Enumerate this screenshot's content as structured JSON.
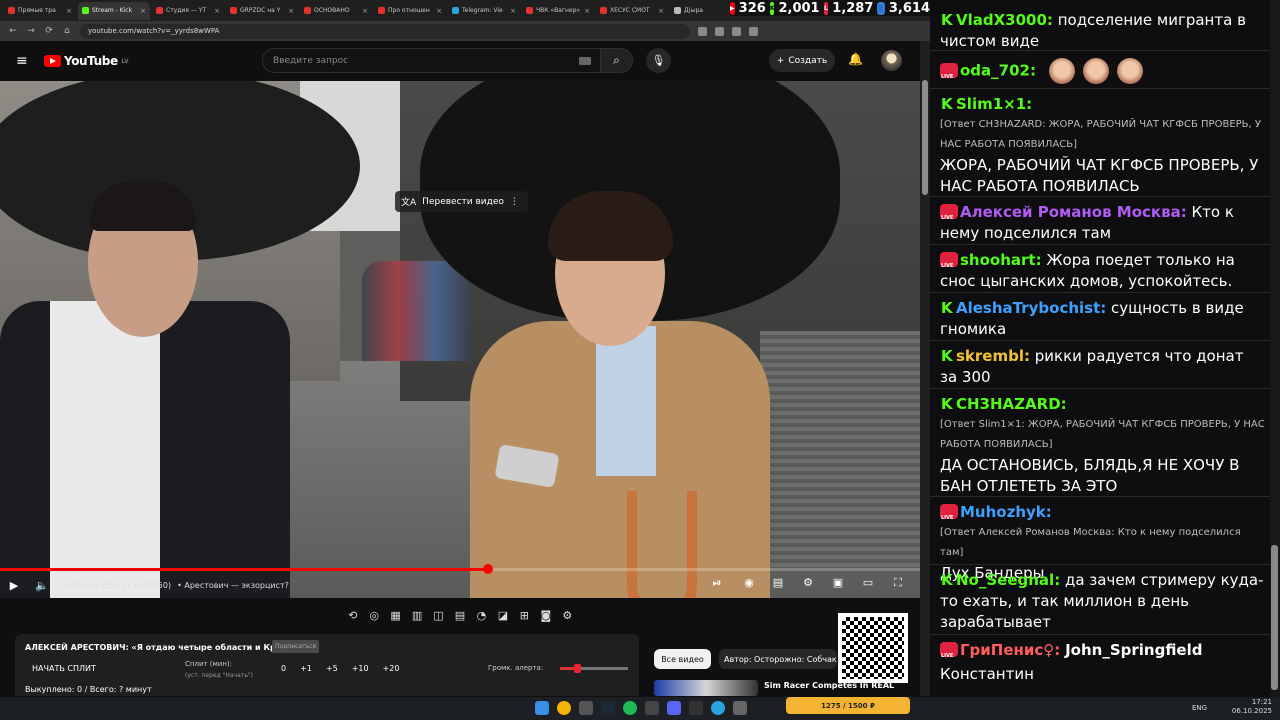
{
  "browser": {
    "tabs": [
      {
        "label": "Прямые тра",
        "color": "#e5302d"
      },
      {
        "label": "Stream - Kick",
        "color": "#53fc18"
      },
      {
        "label": "Студия — YT",
        "color": "#e5302d"
      },
      {
        "label": "GRPZDC на Y",
        "color": "#e5302d"
      },
      {
        "label": "ОСНОВАНО",
        "color": "#e5302d"
      },
      {
        "label": "Про отношен",
        "color": "#e5302d"
      },
      {
        "label": "Telegram: Vie",
        "color": "#2aa3df"
      },
      {
        "label": "ЧВК «Вагнер»",
        "color": "#e5302d"
      },
      {
        "label": "ХЕСУС СМОТ",
        "color": "#e5302d"
      },
      {
        "label": "Д|ыра",
        "color": "#bbbbbb"
      }
    ],
    "url": "youtube.com/watch?v=_yyrds8wWPA"
  },
  "stream_stats": {
    "youtube": "326",
    "kick": "2,001",
    "live": "1,287",
    "total": "3,614"
  },
  "youtube": {
    "logo_text": "YouTube",
    "region": "LV",
    "search_placeholder": "Введите запрос",
    "create_label": "Создать",
    "translate_label": "Перевести видео",
    "time": "1:31:15 / 2:54:11 (2:50:50)",
    "chapter": "• Арестович — экзорцист?",
    "progress": 0.53
  },
  "panel": {
    "title": "АЛЕКСЕЙ АРЕСТОВИЧ: «Я отдаю четыре области и Крым»",
    "subscribe": "Подписаться",
    "split_button": "НАЧАТЬ СПЛИТ",
    "split_label": "Сплит (мин):",
    "split_hint": "(уст. перед \"Начать\")",
    "split_values": [
      "0",
      "+1",
      "+5",
      "+10",
      "+20"
    ],
    "alert_label": "Громк. алерта:",
    "alert_level": 0.3,
    "bought": "Выкуплено: 0 / Всего: ? минут"
  },
  "recommendations": {
    "all_videos": "Все видео",
    "author": "Автор: Осторожно: Собчак",
    "rec_title": "Sim Racer Competes In REAL"
  },
  "donation_bar": "1275 / 1500 ₽",
  "chat": [
    {
      "badge": "kick",
      "nick": "VladX3000:",
      "color": "#53fc18",
      "text": "подселение мигранта в чистом виде"
    },
    {
      "badge": "live",
      "nick": "oda_702:",
      "color": "#53fc18",
      "text": ""
    },
    {
      "badge": "kick",
      "nick": "Slim1×1:",
      "color": "#53fc18",
      "reply": "[Ответ CH3HAZARD: ЖОРА, РАБОЧИЙ ЧАТ КГФСБ ПРОВЕРЬ, У НАС РАБОТА ПОЯВИЛАСЬ]",
      "text": "ЖОРА, РАБОЧИЙ ЧАТ КГФСБ ПРОВЕРЬ, У НАС РАБОТА ПОЯВИЛАСЬ"
    },
    {
      "badge": "live",
      "nick": "Алексей Романов Москва:",
      "color": "#b05cf5",
      "text": "Кто к нему подселился там"
    },
    {
      "badge": "live",
      "nick": "shoohart:",
      "color": "#53fc18",
      "text": "Жора поедет только на снос цыганских домов, успокойтесь."
    },
    {
      "badge": "kick",
      "nick": "AleshaTrybochist:",
      "color": "#3fa0ff",
      "text": "сущность в виде гномика"
    },
    {
      "badge": "kick",
      "nick": "skrembl:",
      "color": "#f1c232",
      "text": "рикки радуется что донат за 300"
    },
    {
      "badge": "kick",
      "nick": "CH3HAZARD:",
      "color": "#53fc18",
      "reply": "[Ответ Slim1×1: ЖОРА, РАБОЧИЙ ЧАТ КГФСБ ПРОВЕРЬ, У НАС РАБОТА ПОЯВИЛАСЬ]",
      "text": "ДА ОСТАНОВИСЬ, БЛЯДЬ,Я НЕ ХОЧУ В БАН ОТЛЕТЕТЬ ЗА ЭТО"
    },
    {
      "badge": "live",
      "nick": "Muhozhyk:",
      "color": "#3fa0ff",
      "reply": "[Ответ Алексей Романов Москва: Кто к нему подселился там]",
      "text": "Дух Бандеры"
    },
    {
      "badge": "kick",
      "nick": "No_Seegnal:",
      "color": "#53fc18",
      "text": "да зачем стримеру куда-то ехать, и так миллион в день зарабатывает"
    },
    {
      "badge": "live",
      "nick": "ГриПенис♀:",
      "color": "#ff5c5c",
      "text": "John_Springfield"
    },
    {
      "badge": "",
      "nick": "",
      "color": "#ffffff",
      "text": "Константин"
    }
  ],
  "taskbar": {
    "lang": "ENG",
    "time": "17:21",
    "date": "06.10.2025"
  }
}
